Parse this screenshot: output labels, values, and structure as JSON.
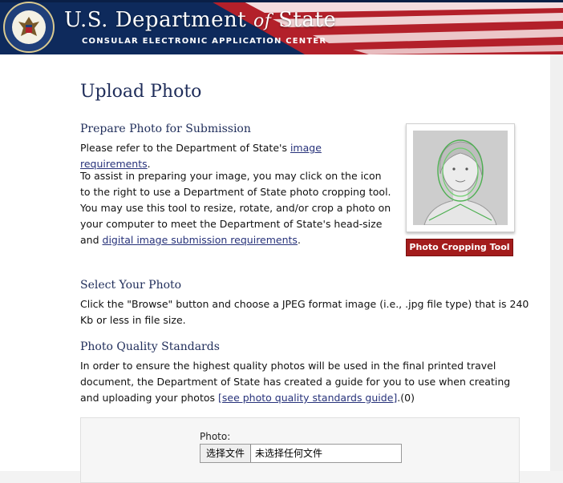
{
  "banner": {
    "title_left": "U.S. Department",
    "title_of": "of",
    "title_right": "State",
    "subtitle": "CONSULAR ELECTRONIC APPLICATION CENTER"
  },
  "page": {
    "title": "Upload Photo",
    "prepare": {
      "heading": "Prepare Photo for Submission",
      "refer_pre": "Please refer to the Department of State's ",
      "refer_link": "image requirements",
      "refer_post": ".",
      "assist_text": "To assist in preparing your image, you may click on the icon to the right to use a Department of State photo cropping tool. You may use this tool to resize, rotate, and/or crop a photo on your computer to meet the Department of State's head-size and",
      "assist_link": "digital image submission requirements",
      "assist_post": "."
    },
    "crop_tool_label": "Photo Cropping Tool",
    "select": {
      "heading": "Select Your Photo",
      "text": "Click the \"Browse\" button and choose a JPEG format image (i.e., .jpg file type) that is 240 Kb or less in file size."
    },
    "quality": {
      "heading": "Photo Quality Standards",
      "text": "In order to ensure the highest quality photos will be used in the final printed travel document, the Department of State has created a guide for you to use when creating and uploading your photos ",
      "link": "[see photo quality standards guide]",
      "post": ".(0)"
    },
    "upload": {
      "label": "Photo:",
      "button": "选择文件",
      "status": "未选择任何文件"
    }
  },
  "colors": {
    "navy": "#1f2d5a",
    "banner_red": "#b3202a",
    "crop_button": "#a31c1c",
    "link": "#27327a"
  }
}
